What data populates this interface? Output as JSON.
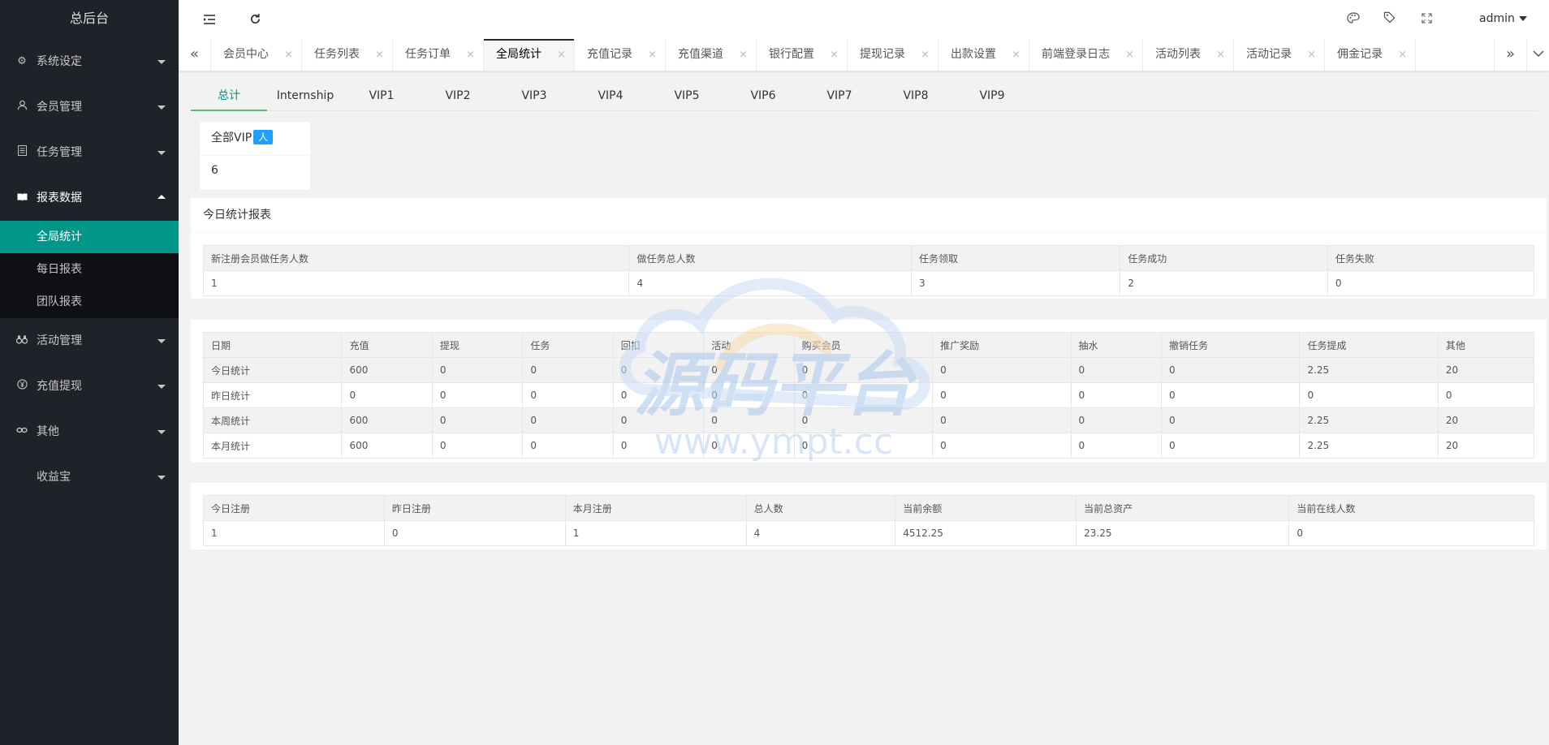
{
  "app": {
    "title": "总后台"
  },
  "sidebar": {
    "items": [
      {
        "label": "系统设定",
        "icon": "gear-icon"
      },
      {
        "label": "会员管理",
        "icon": "user-icon"
      },
      {
        "label": "任务管理",
        "icon": "document-icon"
      },
      {
        "label": "报表数据",
        "icon": "book-icon"
      },
      {
        "label": "活动管理",
        "icon": "binoculars-icon"
      },
      {
        "label": "充值提现",
        "icon": "yen-icon"
      },
      {
        "label": "其他",
        "icon": "link-icon"
      },
      {
        "label": "收益宝",
        "icon": ""
      }
    ],
    "report_sub": [
      "全局统计",
      "每日报表",
      "团队报表"
    ]
  },
  "header": {
    "user": "admin"
  },
  "tabs": [
    {
      "label": "会员中心"
    },
    {
      "label": "任务列表"
    },
    {
      "label": "任务订单"
    },
    {
      "label": "全局统计"
    },
    {
      "label": "充值记录"
    },
    {
      "label": "充值渠道"
    },
    {
      "label": "银行配置"
    },
    {
      "label": "提现记录"
    },
    {
      "label": "出款设置"
    },
    {
      "label": "前端登录日志"
    },
    {
      "label": "活动列表"
    },
    {
      "label": "活动记录"
    },
    {
      "label": "佣金记录"
    }
  ],
  "tab_close": "×",
  "vip_tabs": [
    "总计",
    "Internship",
    "VIP1",
    "VIP2",
    "VIP3",
    "VIP4",
    "VIP5",
    "VIP6",
    "VIP7",
    "VIP8",
    "VIP9"
  ],
  "vip_card": {
    "title": "全部VIP",
    "badge": "人",
    "value": "6"
  },
  "today_report": {
    "title": "今日统计报表",
    "headers": [
      "新注册会员做任务人数",
      "做任务总人数",
      "任务领取",
      "任务成功",
      "任务失败"
    ],
    "row": [
      "1",
      "4",
      "3",
      "2",
      "0"
    ]
  },
  "summary": {
    "headers": [
      "日期",
      "充值",
      "提现",
      "任务",
      "回扣",
      "活动",
      "购买会员",
      "推广奖励",
      "抽水",
      "撤销任务",
      "任务提成",
      "其他"
    ],
    "rows": [
      [
        "今日统计",
        "600",
        "0",
        "0",
        "0",
        "0",
        "0",
        "0",
        "0",
        "0",
        "2.25",
        "20"
      ],
      [
        "昨日统计",
        "0",
        "0",
        "0",
        "0",
        "0",
        "0",
        "0",
        "0",
        "0",
        "0",
        "0"
      ],
      [
        "本周统计",
        "600",
        "0",
        "0",
        "0",
        "0",
        "0",
        "0",
        "0",
        "0",
        "2.25",
        "20"
      ],
      [
        "本月统计",
        "600",
        "0",
        "0",
        "0",
        "0",
        "0",
        "0",
        "0",
        "0",
        "2.25",
        "20"
      ]
    ]
  },
  "registration": {
    "headers": [
      "今日注册",
      "昨日注册",
      "本月注册",
      "总人数",
      "当前余额",
      "当前总资产",
      "当前在线人数"
    ],
    "row": [
      "1",
      "0",
      "1",
      "4",
      "4512.25",
      "23.25",
      "0"
    ]
  },
  "watermark": {
    "title": "源码平台",
    "url": "www.ympt.cc"
  }
}
